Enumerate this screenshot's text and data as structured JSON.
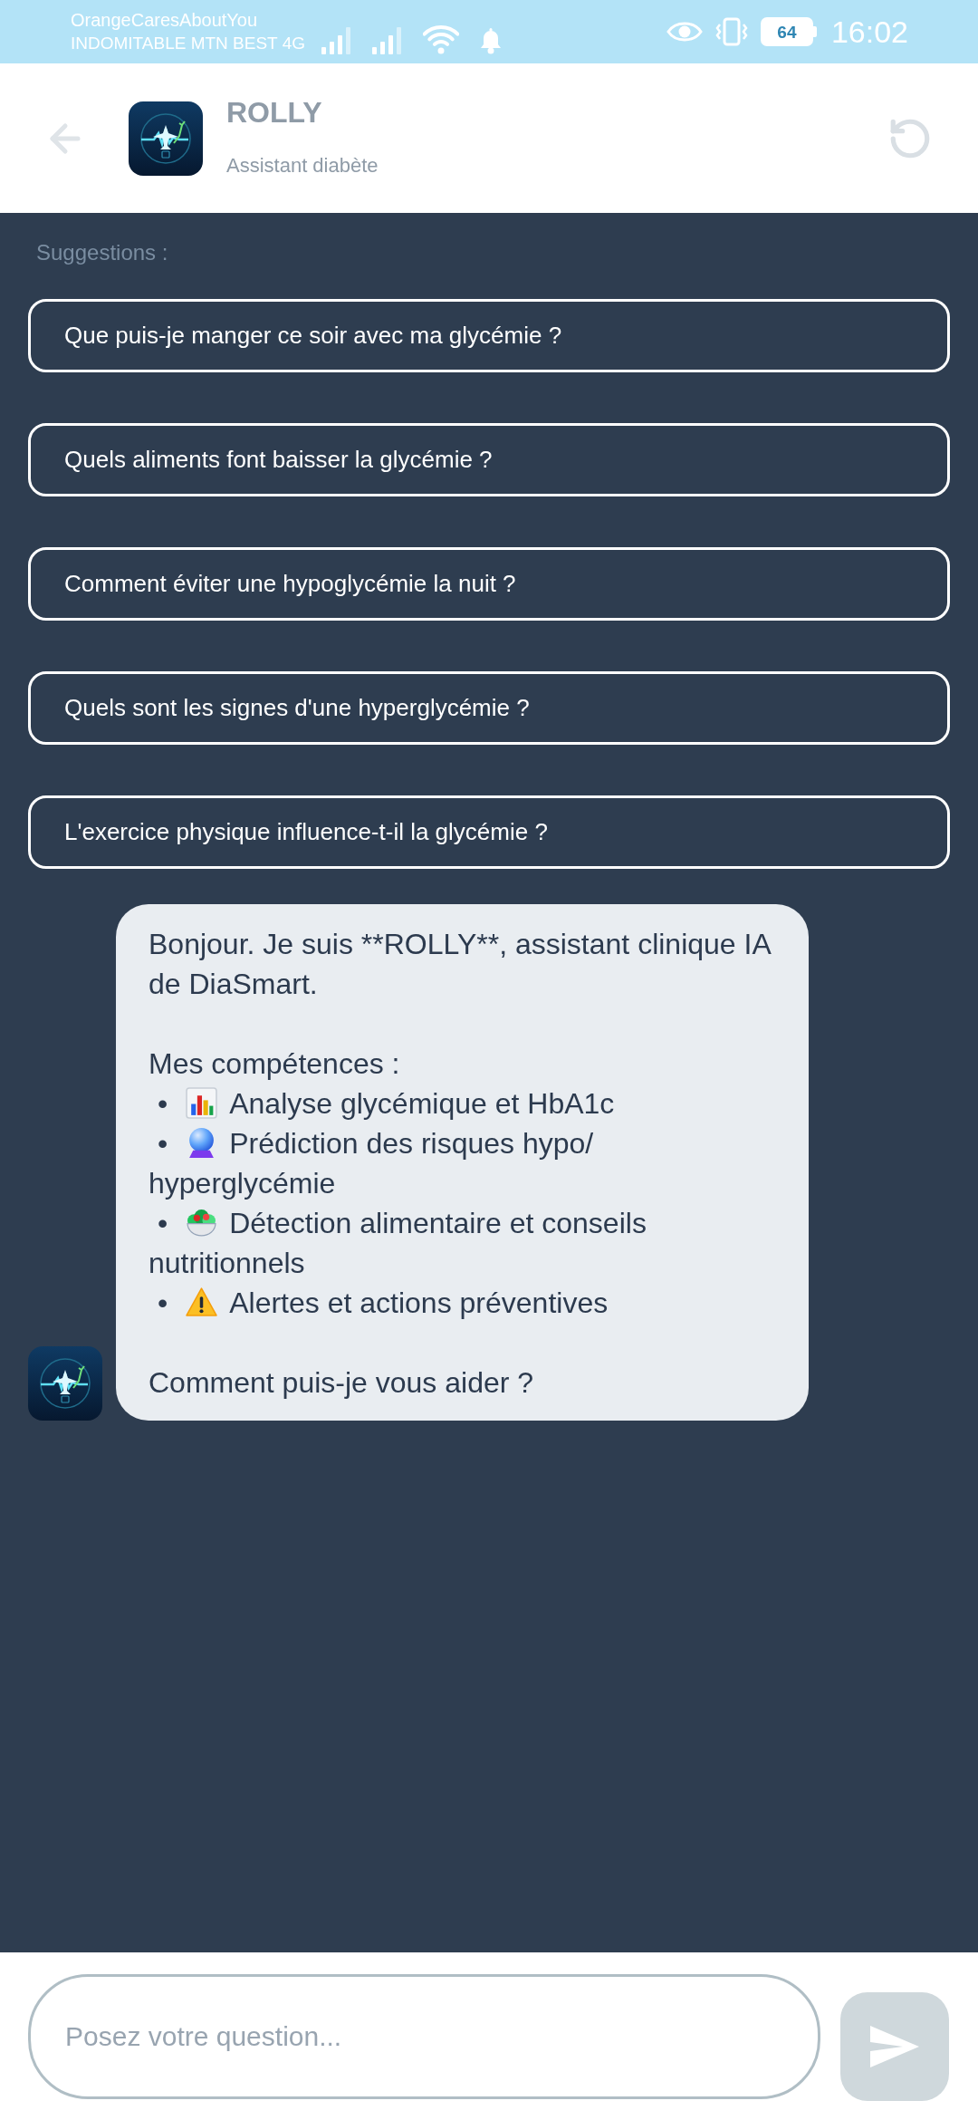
{
  "status_bar": {
    "carrier_primary": "OrangeCaresAboutYou",
    "carrier_secondary": "INDOMITABLE MTN BEST 4G",
    "battery": "64",
    "time": "16:02"
  },
  "header": {
    "title": "ROLLY",
    "subtitle": "Assistant diabète"
  },
  "suggestions": {
    "label": "Suggestions :",
    "items": [
      "Que puis-je manger ce soir avec ma glycémie ?",
      "Quels aliments font baisser la glycémie ?",
      "Comment éviter une hypoglycémie la nuit ?",
      "Quels sont les signes d'une hyperglycémie ?",
      "L'exercice physique influence-t-il la glycémie ?"
    ]
  },
  "message": {
    "intro": "Bonjour. Je suis **ROLLY**, assistant clinique IA de DiaSmart.",
    "heading": "Mes compétences :",
    "items": [
      {
        "kind": "chart",
        "bullet": "•",
        "text": "Analyse glycémique et HbA1c"
      },
      {
        "kind": "crystal_ball",
        "bullet": "•",
        "text": "Prédiction des risques hypo/hyperglycémie"
      },
      {
        "kind": "salad",
        "bullet": "•",
        "text": "Détection alimentaire et conseils nutritionnels"
      },
      {
        "kind": "warning",
        "bullet": "•",
        "text": "Alertes et actions préventives"
      }
    ],
    "closing": "Comment puis-je vous aider ?"
  },
  "composer": {
    "placeholder": "Posez votre question...",
    "send_disabled": true
  }
}
